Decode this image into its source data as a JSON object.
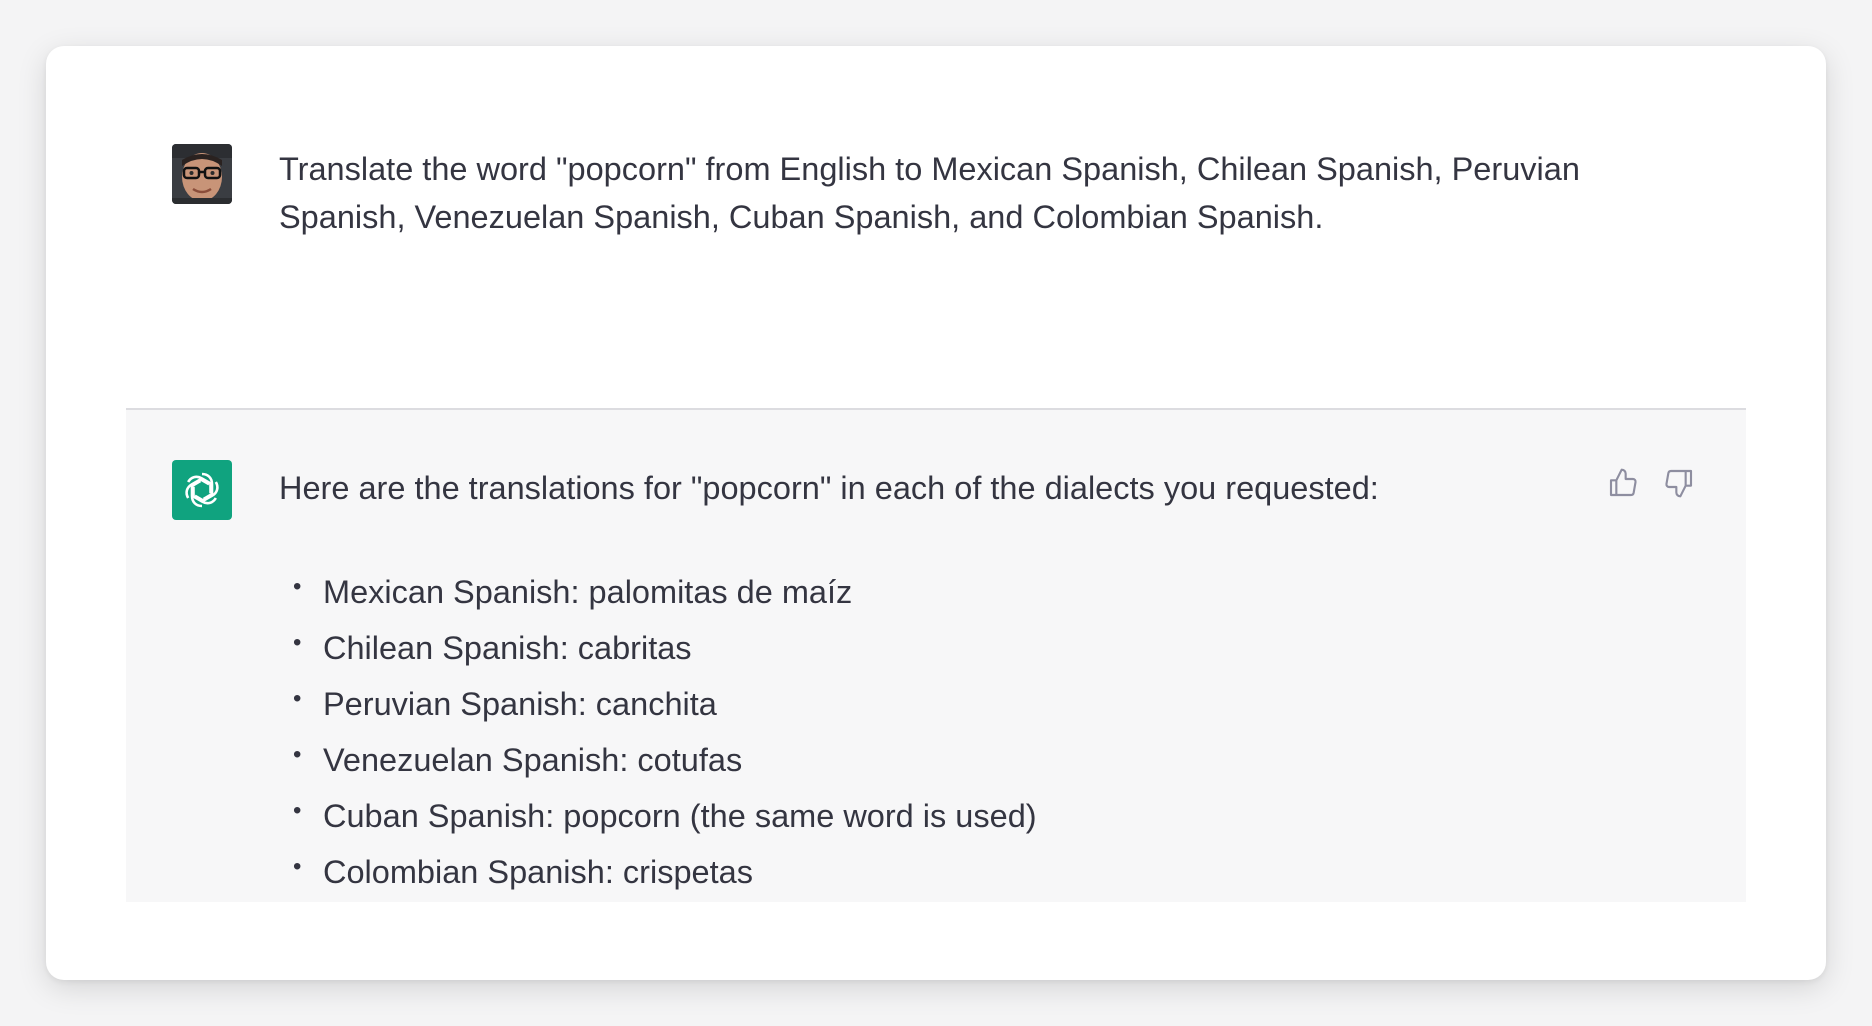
{
  "conversation": {
    "user_message": "Translate the word \"popcorn\" from English to Mexican Spanish, Chilean Spanish, Peruvian Spanish, Venezuelan Spanish, Cuban Spanish, and Colombian Spanish.",
    "assistant_intro": "Here are the translations for \"popcorn\" in each of the dialects you requested:",
    "translations": [
      "Mexican Spanish: palomitas de maíz",
      "Chilean Spanish: cabritas",
      "Peruvian Spanish: canchita",
      "Venezuelan Spanish: cotufas",
      "Cuban Spanish: popcorn (the same word is used)",
      "Colombian Spanish: crispetas"
    ],
    "bullet": "•"
  },
  "icons": {
    "user_avatar": "user-avatar-photo",
    "assistant_avatar": "openai-logo-icon",
    "thumbs_up": "thumbs-up-icon",
    "thumbs_down": "thumbs-down-icon"
  },
  "colors": {
    "assistant_bg": "#f7f7f8",
    "assistant_avatar_bg": "#10a37f",
    "text": "#343541",
    "icon": "#8e8ea0"
  }
}
